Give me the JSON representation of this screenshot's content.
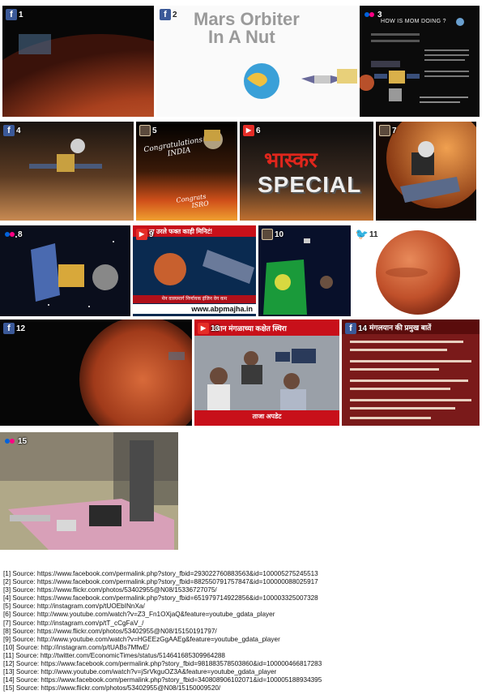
{
  "tiles": [
    {
      "number": "1",
      "source_icon": "facebook-icon"
    },
    {
      "number": "2",
      "source_icon": "facebook-icon",
      "overlay": [
        "Mars Orbiter",
        "In A Nut"
      ]
    },
    {
      "number": "3",
      "source_icon": "flickr-icon",
      "overlay": [
        "HOW IS MOM DOING ?"
      ]
    },
    {
      "number": "4",
      "source_icon": "facebook-icon"
    },
    {
      "number": "5",
      "source_icon": "instagram-icon",
      "overlay": [
        "Congratulations",
        "INDIA",
        "Congrats",
        "ISRO"
      ]
    },
    {
      "number": "6",
      "source_icon": "youtube-icon",
      "overlay": [
        "भास्कर",
        "SPECIAL"
      ]
    },
    {
      "number": "7",
      "source_icon": "instagram-icon"
    },
    {
      "number": "8",
      "source_icon": "flickr-icon"
    },
    {
      "number": "9",
      "source_icon": "youtube-icon",
      "overlay": [
        "ता उरले फक्त काही मिनिटं!",
        "मेन वास्यमार्ग निर्णायक इंजिन वेग कम",
        "www.abpmajha.in"
      ]
    },
    {
      "number": "10",
      "source_icon": "instagram-icon"
    },
    {
      "number": "11",
      "source_icon": "twitter-icon"
    },
    {
      "number": "12",
      "source_icon": "facebook-icon"
    },
    {
      "number": "13",
      "source_icon": "youtube-icon",
      "overlay": [
        "तयान मंगळाच्या कक्षेत स्थिरा",
        "ताजा अपडेट"
      ]
    },
    {
      "number": "14",
      "source_icon": "facebook-icon",
      "overlay": [
        "मंगलयान की प्रमुख बातें"
      ]
    },
    {
      "number": "15",
      "source_icon": "flickr-icon"
    }
  ],
  "colors": {
    "facebook": "#3b5998",
    "youtube": "#e52d27",
    "twitter": "#55acee",
    "flickr_blue": "#0063dc",
    "flickr_pink": "#ff0084",
    "mars": "#c1502e"
  },
  "sources": [
    "[1] Source: https://www.facebook.com/permalink.php?story_fbid=293022760883563&id=100005275245513",
    "[2] Source: https://www.facebook.com/permalink.php?story_fbid=882550791757847&id=100000088025917",
    "[3] Source: https://www.flickr.com/photos/53402955@N08/15336727075/",
    "[4] Source: https://www.facebook.com/permalink.php?story_fbid=651979714922856&id=100003325007328",
    "[5] Source: http://instagram.com/p/tUOEbINnXa/",
    "[6] Source: http://www.youtube.com/watch?v=Z3_Fn1OXjaQ&feature=youtube_gdata_player",
    "[7] Source: http://instagram.com/p/tT_cCgFaV_/",
    "[8] Source: https://www.flickr.com/photos/53402955@N08/15150191797/",
    "[9] Source: http://www.youtube.com/watch?v=HGEEzGgAAEg&feature=youtube_gdata_player",
    "[10] Source: http://instagram.com/p/tUABs7MfwE/",
    "[11] Source: http://twitter.com/EconomicTimes/status/514641685309964288",
    "[12] Source: https://www.facebook.com/permalink.php?story_fbid=981883578503860&id=100000466817283",
    "[13] Source: http://www.youtube.com/watch?v=jSrVkguOZ3A&feature=youtube_gdata_player",
    "[14] Source: https://www.facebook.com/permalink.php?story_fbid=340808906102071&id=100005188934395",
    "[15] Source: https://www.flickr.com/photos/53402955@N08/15150009520/"
  ]
}
